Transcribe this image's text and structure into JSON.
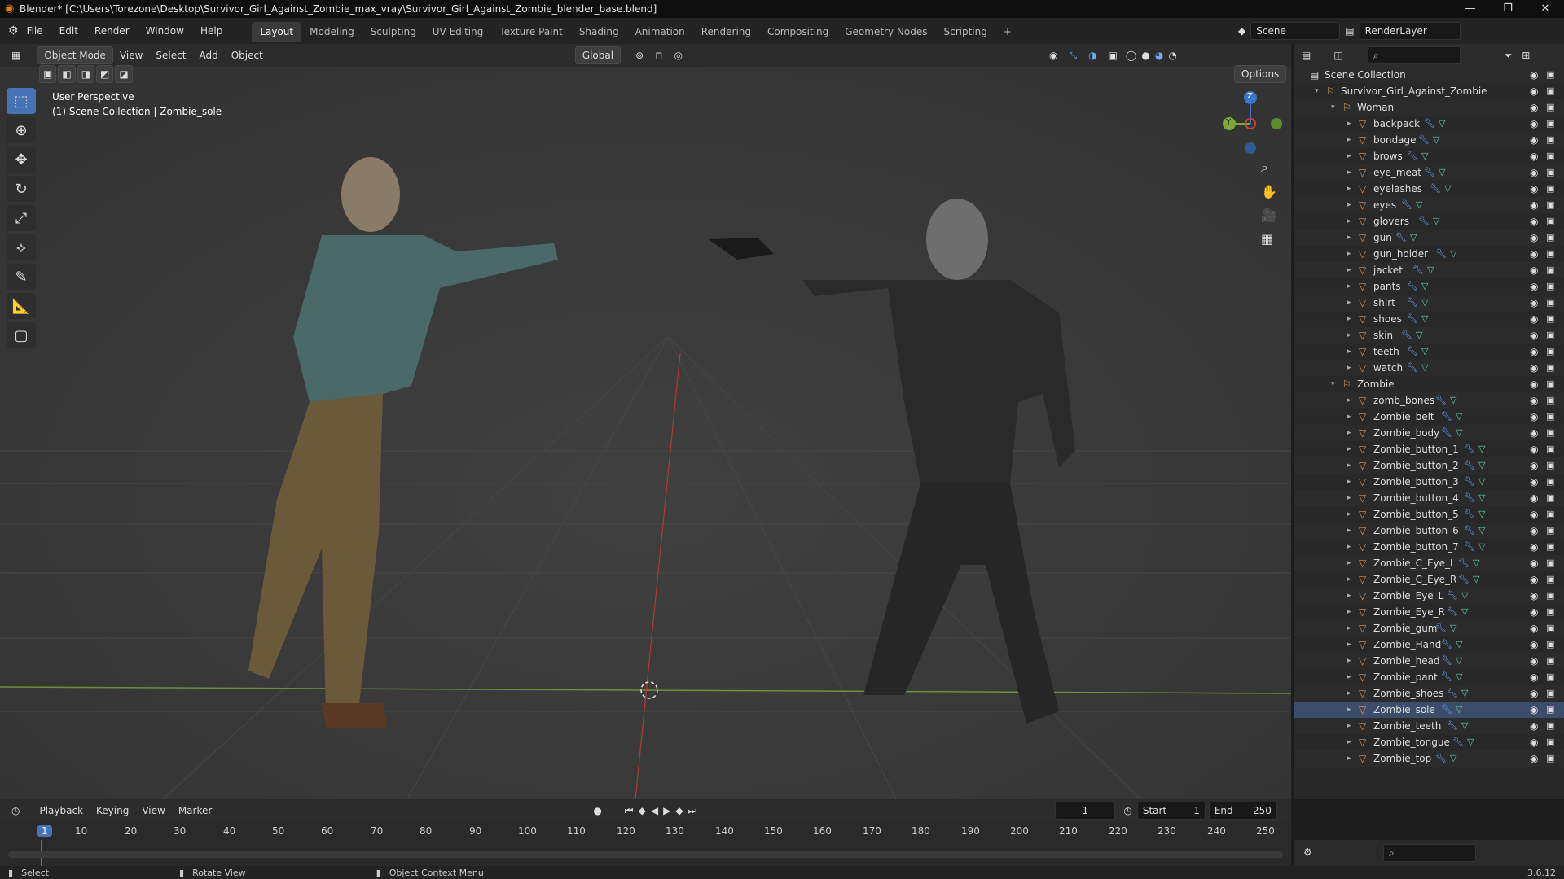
{
  "window": {
    "title": "Blender* [C:\\Users\\Torezone\\Desktop\\Survivor_Girl_Against_Zombie_max_vray\\Survivor_Girl_Against_Zombie_blender_base.blend]",
    "controls": [
      "—",
      "❐",
      "✕"
    ]
  },
  "menu": [
    "File",
    "Edit",
    "Render",
    "Window",
    "Help"
  ],
  "workspaces": [
    "Layout",
    "Modeling",
    "Sculpting",
    "UV Editing",
    "Texture Paint",
    "Shading",
    "Animation",
    "Rendering",
    "Compositing",
    "Geometry Nodes",
    "Scripting",
    "+"
  ],
  "active_workspace": "Layout",
  "scene": {
    "name": "Scene",
    "view_layer": "RenderLayer"
  },
  "viewport": {
    "mode": "Object Mode",
    "menus": [
      "View",
      "Select",
      "Add",
      "Object"
    ],
    "transform": "Global",
    "options": "Options",
    "info_line1": "User Perspective",
    "info_line2": "(1) Scene Collection | Zombie_sole",
    "gizmo": {
      "z": "Z",
      "y": "Y"
    }
  },
  "outliner": {
    "root": "Scene Collection",
    "collection": "Survivor_Girl_Against_Zombie",
    "woman": "Woman",
    "woman_items": [
      "backpack",
      "bondage",
      "brows",
      "eye_meat",
      "eyelashes",
      "eyes",
      "glovers",
      "gun",
      "gun_holder",
      "jacket",
      "pants",
      "shirt",
      "shoes",
      "skin",
      "teeth",
      "watch"
    ],
    "zombie": "Zombie",
    "zombie_items": [
      "zomb_bones",
      "Zombie_belt",
      "Zombie_body",
      "Zombie_button_1",
      "Zombie_button_2",
      "Zombie_button_3",
      "Zombie_button_4",
      "Zombie_button_5",
      "Zombie_button_6",
      "Zombie_button_7",
      "Zombie_C_Eye_L",
      "Zombie_C_Eye_R",
      "Zombie_Eye_L",
      "Zombie_Eye_R",
      "Zombie_gum",
      "Zombie_Hand",
      "Zombie_head",
      "Zombie_pant",
      "Zombie_shoes",
      "Zombie_sole",
      "Zombie_teeth",
      "Zombie_tongue",
      "Zombie_top"
    ],
    "selected": "Zombie_sole"
  },
  "timeline": {
    "menus": [
      "Playback",
      "Keying",
      "View",
      "Marker"
    ],
    "current_frame": "1",
    "start_label": "Start",
    "start": "1",
    "end_label": "End",
    "end": "250",
    "ticks": [
      "1",
      "10",
      "20",
      "30",
      "40",
      "50",
      "60",
      "70",
      "80",
      "90",
      "100",
      "110",
      "120",
      "130",
      "140",
      "150",
      "160",
      "170",
      "180",
      "190",
      "200",
      "210",
      "220",
      "230",
      "240",
      "250"
    ]
  },
  "status": {
    "select": "Select",
    "rotate": "Rotate View",
    "context": "Object Context Menu",
    "version": "3.6.12"
  }
}
